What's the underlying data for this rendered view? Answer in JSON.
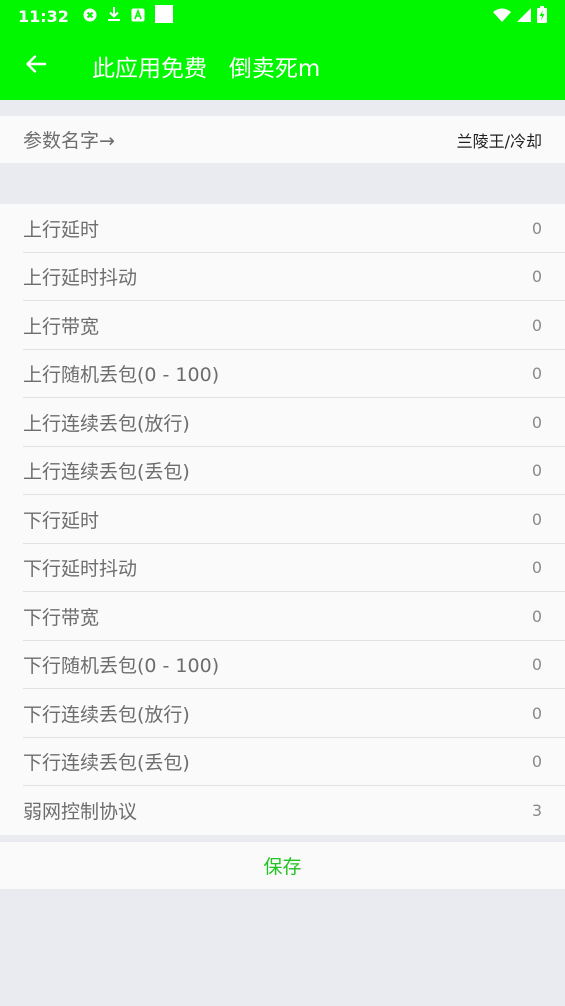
{
  "status_bar": {
    "time": "11:32",
    "icons_left": [
      "settings-notification-icon",
      "download-icon",
      "a-badge-icon",
      "square-icon"
    ],
    "icons_right": [
      "wifi-icon",
      "signal-icon",
      "battery-charging-icon"
    ]
  },
  "toolbar": {
    "back_icon": "arrow-left-icon",
    "title": "此应用免费   倒卖死m"
  },
  "profile": {
    "label": "参数名字→",
    "value": "兰陵王/冷却"
  },
  "params": [
    {
      "label": "上行延时",
      "value": "0"
    },
    {
      "label": "上行延时抖动",
      "value": "0"
    },
    {
      "label": "上行带宽",
      "value": "0"
    },
    {
      "label": "上行随机丢包(0 - 100)",
      "value": "0"
    },
    {
      "label": "上行连续丢包(放行)",
      "value": "0"
    },
    {
      "label": "上行连续丢包(丢包)",
      "value": "0"
    },
    {
      "label": "下行延时",
      "value": "0"
    },
    {
      "label": "下行延时抖动",
      "value": "0"
    },
    {
      "label": "下行带宽",
      "value": "0"
    },
    {
      "label": "下行随机丢包(0 - 100)",
      "value": "0"
    },
    {
      "label": "下行连续丢包(放行)",
      "value": "0"
    },
    {
      "label": "下行连续丢包(丢包)",
      "value": "0"
    },
    {
      "label": "弱网控制协议",
      "value": "3"
    }
  ],
  "save_label": "保存",
  "colors": {
    "toolbar_bg": "#00f700",
    "save_text": "#22c322",
    "page_bg": "#e9ebf0"
  }
}
